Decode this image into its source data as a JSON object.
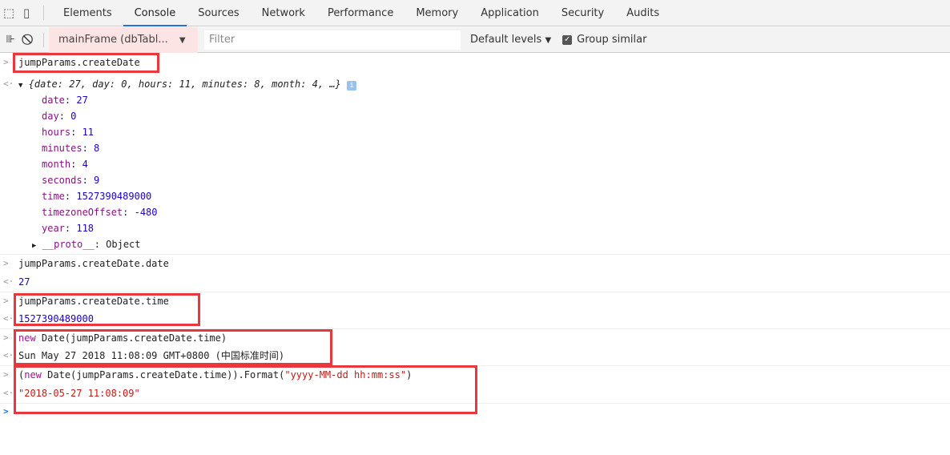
{
  "tabs": [
    "Elements",
    "Console",
    "Sources",
    "Network",
    "Performance",
    "Memory",
    "Application",
    "Security",
    "Audits"
  ],
  "active_tab": "Console",
  "toolbar": {
    "context": "mainFrame (dbTabl...",
    "filter_placeholder": "Filter",
    "levels": "Default levels",
    "group_similar": "Group similar",
    "group_similar_checked": true
  },
  "console": {
    "cmd1": "jumpParams.createDate",
    "obj_preview": "{date: 27, day: 0, hours: 11, minutes: 8, month: 4, …}",
    "props": [
      [
        "date",
        "27"
      ],
      [
        "day",
        "0"
      ],
      [
        "hours",
        "11"
      ],
      [
        "minutes",
        "8"
      ],
      [
        "month",
        "4"
      ],
      [
        "seconds",
        "9"
      ],
      [
        "time",
        "1527390489000"
      ],
      [
        "timezoneOffset",
        "-480"
      ],
      [
        "year",
        "118"
      ]
    ],
    "proto_key": "__proto__",
    "proto_val": "Object",
    "cmd2": "jumpParams.createDate.date",
    "res2": "27",
    "cmd3": "jumpParams.createDate.time",
    "res3": "1527390489000",
    "cmd4_kw": "new",
    "cmd4_rest": " Date(jumpParams.createDate.time)",
    "res4": "Sun May 27 2018 11:08:09 GMT+0800 (中国标准时间)",
    "cmd5_a": "(",
    "cmd5_kw": "new",
    "cmd5_b": " Date(jumpParams.createDate.time)).Format(",
    "cmd5_str": "\"yyyy-MM-dd hh:mm:ss\"",
    "cmd5_c": ")",
    "res5": "\"2018-05-27 11:08:09\""
  },
  "colors": {
    "highlight_box": "#e8383d",
    "accent": "#1a73e8"
  }
}
